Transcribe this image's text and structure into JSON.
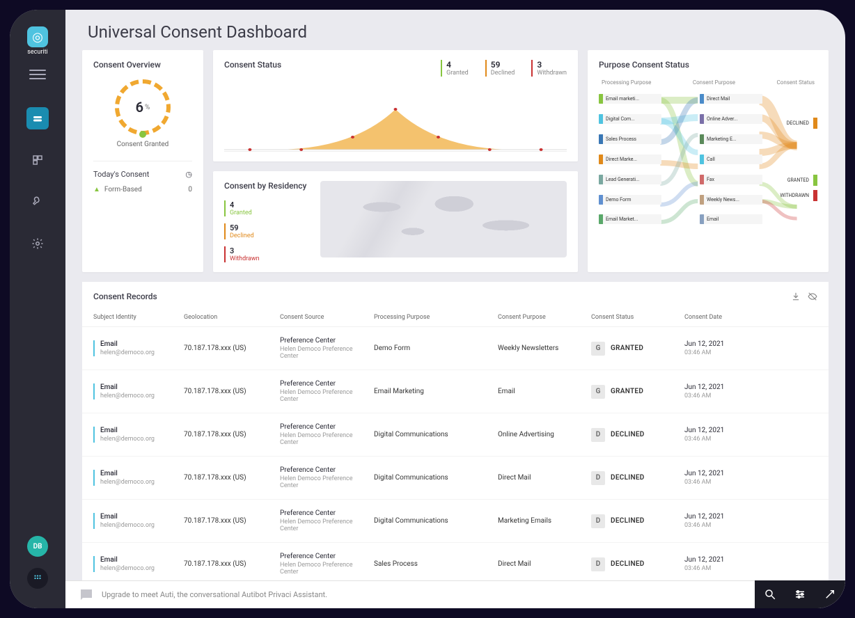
{
  "logo_text": "securiti",
  "page_title": "Universal Consent Dashboard",
  "user_initials": "DB",
  "overview": {
    "title": "Consent Overview",
    "gauge_value": "6",
    "gauge_unit": "%",
    "gauge_label": "Consent Granted",
    "today_label": "Today's Consent",
    "form_based_label": "Form-Based",
    "form_based_count": "0"
  },
  "status": {
    "title": "Consent Status",
    "counts": [
      {
        "num": "4",
        "label": "Granted",
        "class": "granted"
      },
      {
        "num": "59",
        "label": "Declined",
        "class": "declined"
      },
      {
        "num": "3",
        "label": "Withdrawn",
        "class": "withdrawn"
      }
    ]
  },
  "residency": {
    "title": "Consent by Residency",
    "counts": [
      {
        "num": "4",
        "label": "Granted",
        "class": "granted"
      },
      {
        "num": "59",
        "label": "Declined",
        "class": "declined"
      },
      {
        "num": "3",
        "label": "Withdrawn",
        "class": "withdrawn"
      }
    ]
  },
  "purpose": {
    "title": "Purpose Consent Status",
    "col_labels": {
      "left": "Processing Purpose",
      "mid": "Consent Purpose",
      "right": "Consent Status"
    },
    "left_nodes": [
      {
        "label": "Email marketi...",
        "color": "#88c540"
      },
      {
        "label": "Digital Com...",
        "color": "#4fc3e0"
      },
      {
        "label": "Sales Process",
        "color": "#3977b5"
      },
      {
        "label": "Direct Marke...",
        "color": "#e0891a"
      },
      {
        "label": "Lead Generati...",
        "color": "#7aa8a0"
      },
      {
        "label": "Demo Form",
        "color": "#6090d0"
      },
      {
        "label": "Email Market...",
        "color": "#5aa86a"
      }
    ],
    "mid_nodes": [
      {
        "label": "Direct Mail",
        "color": "#4a8bc9"
      },
      {
        "label": "Online Adver...",
        "color": "#7a6fa8"
      },
      {
        "label": "Marketing E...",
        "color": "#5a8a5a"
      },
      {
        "label": "Call",
        "color": "#4fc3e0"
      },
      {
        "label": "Fax",
        "color": "#d06a6a"
      },
      {
        "label": "Weekly News...",
        "color": "#c0a080"
      },
      {
        "label": "Email",
        "color": "#88a0c0"
      }
    ],
    "right_nodes": [
      {
        "label": "DECLINED",
        "color": "#e0891a"
      },
      {
        "label": "GRANTED",
        "color": "#88c540"
      },
      {
        "label": "WITHDRAWN",
        "color": "#c93232"
      }
    ]
  },
  "records": {
    "title": "Consent Records",
    "columns": {
      "subject": "Subject Identity",
      "geo": "Geolocation",
      "src": "Consent Source",
      "pp": "Processing Purpose",
      "cp": "Consent Purpose",
      "cs": "Consent Status",
      "cd": "Consent Date"
    },
    "rows": [
      {
        "id_type": "Email",
        "id_val": "helen@democo.org",
        "geo": "70.187.178.xxx (US)",
        "src": "Preference Center",
        "src_sub": "Helen Democo Preference Center",
        "pp": "Demo Form",
        "cp": "Weekly Newsletters",
        "status": "GRANTED",
        "status_letter": "G",
        "date": "Jun 12, 2021",
        "time": "03:46 AM"
      },
      {
        "id_type": "Email",
        "id_val": "helen@democo.org",
        "geo": "70.187.178.xxx (US)",
        "src": "Preference Center",
        "src_sub": "Helen Democo Preference Center",
        "pp": "Email Marketing",
        "cp": "Email",
        "status": "GRANTED",
        "status_letter": "G",
        "date": "Jun 12, 2021",
        "time": "03:46 AM"
      },
      {
        "id_type": "Email",
        "id_val": "helen@democo.org",
        "geo": "70.187.178.xxx (US)",
        "src": "Preference Center",
        "src_sub": "Helen Democo Preference Center",
        "pp": "Digital Communications",
        "cp": "Online Advertising",
        "status": "DECLINED",
        "status_letter": "D",
        "date": "Jun 12, 2021",
        "time": "03:46 AM"
      },
      {
        "id_type": "Email",
        "id_val": "helen@democo.org",
        "geo": "70.187.178.xxx (US)",
        "src": "Preference Center",
        "src_sub": "Helen Democo Preference Center",
        "pp": "Digital Communications",
        "cp": "Direct Mail",
        "status": "DECLINED",
        "status_letter": "D",
        "date": "Jun 12, 2021",
        "time": "03:46 AM"
      },
      {
        "id_type": "Email",
        "id_val": "helen@democo.org",
        "geo": "70.187.178.xxx (US)",
        "src": "Preference Center",
        "src_sub": "Helen Democo Preference Center",
        "pp": "Digital Communications",
        "cp": "Marketing Emails",
        "status": "DECLINED",
        "status_letter": "D",
        "date": "Jun 12, 2021",
        "time": "03:46 AM"
      },
      {
        "id_type": "Email",
        "id_val": "helen@democo.org",
        "geo": "70.187.178.xxx (US)",
        "src": "Preference Center",
        "src_sub": "Helen Democo Preference Center",
        "pp": "Sales Process",
        "cp": "Direct Mail",
        "status": "DECLINED",
        "status_letter": "D",
        "date": "Jun 12, 2021",
        "time": "03:46 AM"
      }
    ]
  },
  "footer_text": "Upgrade to meet Auti, the conversational Autibot Privaci Assistant."
}
